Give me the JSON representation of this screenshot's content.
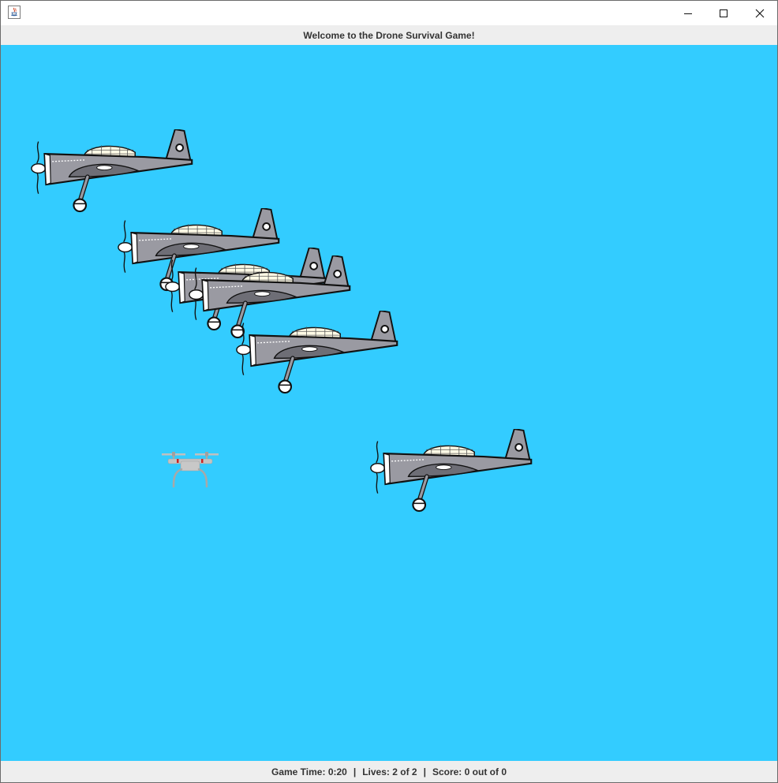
{
  "window": {
    "title": "",
    "controls": [
      "minimize-icon",
      "maximize-icon",
      "close-icon"
    ]
  },
  "header": {
    "text": "Welcome to the Drone Survival Game!"
  },
  "game": {
    "background_color": "#33ccff",
    "player": {
      "type": "drone",
      "icon": "drone-icon"
    },
    "enemies": {
      "type": "propeller-plane",
      "count": 6
    }
  },
  "status": {
    "game_time_label": "Game Time:",
    "game_time": "0:20",
    "separator": "|",
    "lives_label": "Lives:",
    "lives": "2 of 2",
    "score_label": "Score:",
    "score": "0 out of 0"
  }
}
